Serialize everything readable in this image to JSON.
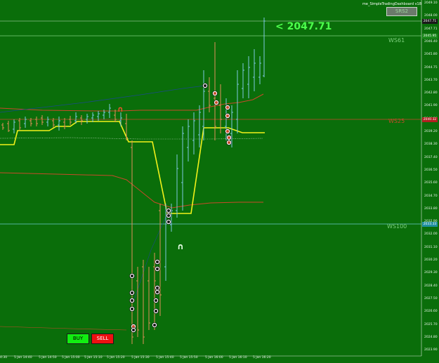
{
  "indicator_title": "me_SimpleTradingDashboard v18",
  "ws_button_label": "SRS2",
  "current_price_label": "< 2047.71",
  "levels": [
    {
      "label": "WS61",
      "price": 2045.95,
      "color": "#7ed07e"
    },
    {
      "label": "WS25",
      "price": 2040.32,
      "color": "#c84a2a"
    },
    {
      "label": "WS100",
      "price": 2033.33,
      "color": "#7ed07e"
    }
  ],
  "buttons": {
    "buy": "BUY",
    "sell": "SELL"
  },
  "price_axis": {
    "labels": [
      "2049.10",
      "2048.00",
      "2047.71",
      "2046.40",
      "2045.80",
      "2044.75",
      "2043.70",
      "2042.80",
      "2041.90",
      "2040.90",
      "2039.20",
      "2038.30",
      "2037.40",
      "2036.50",
      "2035.60",
      "2034.70",
      "2033.80",
      "2032.90",
      "2032.00",
      "2031.10",
      "2030.20",
      "2029.30",
      "2028.40",
      "2027.50",
      "2026.60",
      "2025.70",
      "2024.80",
      "2023.90"
    ],
    "tags": [
      {
        "text": "2047.71",
        "color": "#1a1a1a"
      },
      {
        "text": "2045.95",
        "color": "#1c8a1c"
      },
      {
        "text": "2040.32",
        "color": "#b02020"
      },
      {
        "text": "2033.33",
        "color": "#2090a0"
      }
    ]
  },
  "time_axis": {
    "labels": [
      "4:30",
      "5 Jan 14:40",
      "5 Jan 14:50",
      "5 Jan 15:00",
      "5 Jan 15:10",
      "5 Jan 15:20",
      "5 Jan 15:30",
      "5 Jan 15:40",
      "5 Jan 15:50",
      "5 Jan 16:00",
      "5 Jan 16:10",
      "5 Jan 16:20"
    ]
  },
  "colors": {
    "background": "#0a6e0a",
    "bull_candle": "#7ec8e0",
    "bear_candle": "#e0905a",
    "yellow_line": "#f2f21a",
    "red_line": "#c84a2a"
  }
}
